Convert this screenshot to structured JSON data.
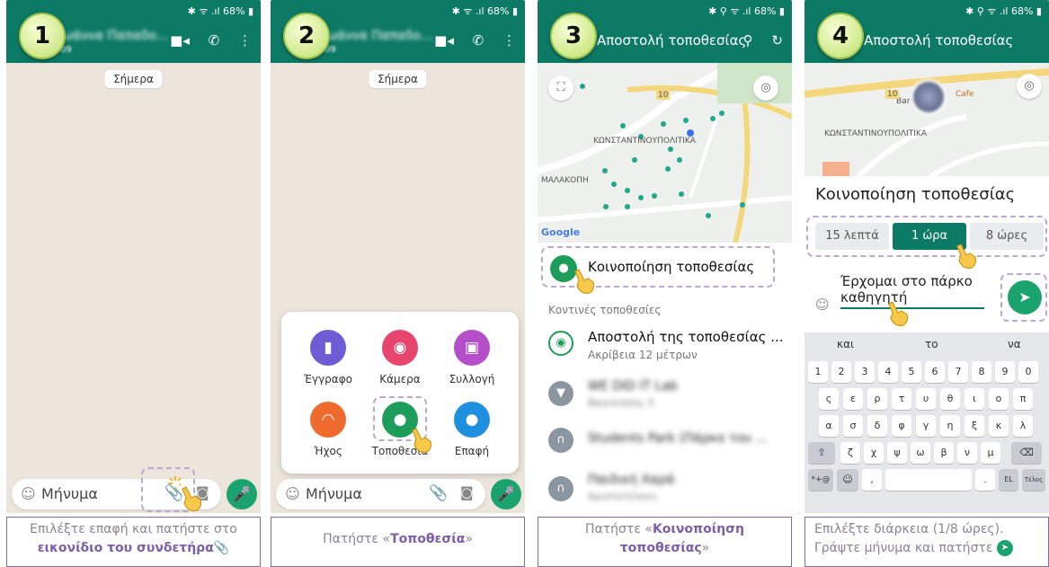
{
  "steps": [
    {
      "number": "1",
      "status_right": "✱ ᯤ .ıl 68% ▮",
      "chat_title": "Ιωάννα Παπαδο...",
      "chat_sub": "09",
      "date_chip": "Σήμερα",
      "message_placeholder": "Μήνυμα",
      "caption_pre": "Επιλέξτε επαφή και πατήστε στο",
      "caption_bold": "εικονίδιο του συνδετήρα",
      "caption_post": "📎"
    },
    {
      "number": "2",
      "status_right": "✱ ᯤ .ıl 68% ▮",
      "chat_title": "Ιωάννα Παπαδο...",
      "chat_sub": "09",
      "date_chip": "Σήμερα",
      "message_placeholder": "Μήνυμα",
      "attachments": [
        {
          "label": "Έγγραφο",
          "color": "#6e5bd6",
          "icon": "▮"
        },
        {
          "label": "Κάμερα",
          "color": "#e8456e",
          "icon": "◉"
        },
        {
          "label": "Συλλογή",
          "color": "#b44fc9",
          "icon": "▣"
        },
        {
          "label": "Ήχος",
          "color": "#ef6a2d",
          "icon": "◠"
        },
        {
          "label": "Τοποθεσία",
          "color": "#1e9c5a",
          "icon": "●"
        },
        {
          "label": "Επαφή",
          "color": "#1f8fe0",
          "icon": "●"
        }
      ],
      "caption_pre": "Πατήστε «",
      "caption_bold": "Τοποθεσία",
      "caption_post": "»"
    },
    {
      "number": "3",
      "status_right": "✱ ⚲ ᯤ .ıl 68% ▮",
      "title": "Αποστολή τοποθεσίας",
      "map_labels": [
        "ΚΩΝΣΤΑΝΤΙΝΟΥΠΟΛΙΤΙΚΑ",
        "ΜΑΛΑΚΟΠΗ",
        "Google",
        "10"
      ],
      "share_live": "Κοινοποίηση τοποθεσίας",
      "nearby_header": "Κοντινές τοποθεσίες",
      "send_current": "Αποστολή της τοποθεσίας ...",
      "accuracy": "Ακρίβεια 12 μέτρων",
      "places": [
        {
          "name": "WE DID IT Lab",
          "sub": "Βασιλίσσης 5"
        },
        {
          "name": "Students Park (Πάρκο του ...",
          "sub": ""
        },
        {
          "name": "Παιδική Χαρά",
          "sub": "Αριστοτέλους"
        }
      ],
      "caption_pre": "Πατήστε «",
      "caption_bold": "Κοινοποίηση τοποθεσίας",
      "caption_post": "»"
    },
    {
      "number": "4",
      "status_right": "✱ ⚲ ᯤ .ıl 68% ▮",
      "title": "Αποστολή τοποθεσίας",
      "map_labels": [
        "ΚΩΝΣΤΑΝΤΙΝΟΥΠΟΛΙΤΙΚΑ",
        "Bar",
        "Cafe",
        "10"
      ],
      "sheet_title": "Κοινοποίηση τοποθεσίας",
      "durations": [
        "15 λεπτά",
        "1 ώρα",
        "8 ώρες"
      ],
      "selected_duration": "1 ώρα",
      "message_text": "Έρχομαι στο πάρκο καθηγητή",
      "suggestions": [
        "και",
        "το",
        "να"
      ],
      "keyboard_rows": [
        [
          "1",
          "2",
          "3",
          "4",
          "5",
          "6",
          "7",
          "8",
          "9",
          "0"
        ],
        [
          "ς",
          "ε",
          "ρ",
          "τ",
          "υ",
          "θ",
          "ι",
          "ο",
          "π"
        ],
        [
          "α",
          "σ",
          "δ",
          "φ",
          "γ",
          "η",
          "ξ",
          "κ",
          "λ"
        ],
        [
          "⇧",
          "ζ",
          "χ",
          "ψ",
          "ω",
          "β",
          "ν",
          "μ",
          "⌫"
        ],
        [
          "*+@",
          "☺",
          ",",
          "",
          ".",
          "EL",
          "Τέλος"
        ]
      ],
      "caption_line1": "Επιλέξτε διάρκεια (1/8 ώρες).",
      "caption_line2": "Γράψτε μήνυμα και πατήστε",
      "caption_icon": "➤"
    }
  ],
  "colors": {
    "whatsapp_teal": "#0d7a66",
    "whatsapp_green": "#1aa36e",
    "caption_border": "#7c6aa5",
    "caption_bold": "#7a5ea8",
    "dashed_highlight": "#b7a9d3",
    "badge": "#cfe98a"
  }
}
